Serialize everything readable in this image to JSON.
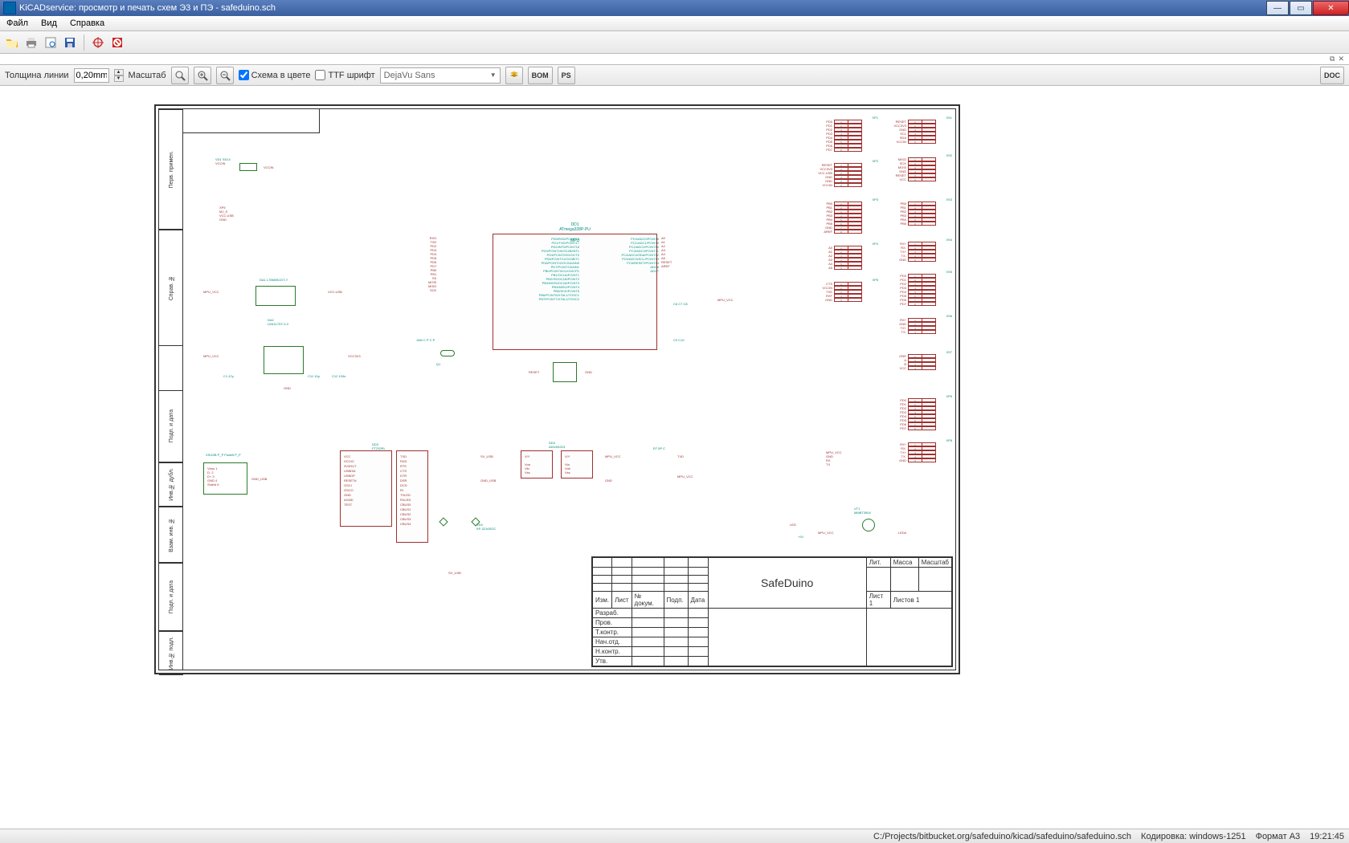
{
  "window": {
    "title": "KiCADservice: просмотр и печать схем Э3 и ПЭ - safeduino.sch"
  },
  "menu": {
    "file": "Файл",
    "view": "Вид",
    "help": "Справка"
  },
  "toolbar": {
    "open": "Открыть",
    "print": "Печать",
    "preview": "Предпросмотр",
    "save": "Сохранить",
    "target": "Цель",
    "stop": "Стоп"
  },
  "options": {
    "line_thickness_label": "Толщина линии",
    "line_thickness_value": "0,20mm",
    "scale_label": "Масштаб",
    "zoom_fit": "Вписать",
    "zoom_in": "+",
    "zoom_out": "−",
    "color_scheme_label": "Схема в цвете",
    "color_scheme_checked": true,
    "ttf_font_label": "TTF шрифт",
    "ttf_font_checked": false,
    "font_combo": "DejaVu Sans",
    "bom_btn": "BOM",
    "ps_btn": "PS",
    "doc_btn": "DOC",
    "tab_restore": "⧉",
    "tab_close": "✕"
  },
  "side_labels": {
    "perv_primen": "Перв. примен.",
    "sprav_no": "Справ. №",
    "podp_data1": "Подп. и дата",
    "inv_dubl": "Инв.№ дубл.",
    "vzam_inv": "Взам. инв. №",
    "podp_data2": "Подп. и дата",
    "inv_podl": "Инв.№ подл."
  },
  "titleblock": {
    "izm": "Изм.",
    "list": "Лист",
    "ndoc": "№ докум.",
    "podp": "Подп.",
    "data": "Дата",
    "razrab": "Разраб.",
    "prov": "Пров.",
    "tkontr": "Т.контр.",
    "nachotd": "Нач.отд.",
    "nkontr": "Н.контр.",
    "utv": "Утв.",
    "project": "SafeDuino",
    "lit": "Лит.",
    "massa": "Масса",
    "mashtab": "Масштаб",
    "list_no": "Лист 1",
    "listov": "Листов 1"
  },
  "schematic": {
    "main_chip_ref": "DD1",
    "main_chip_value": "ATmega328P-PU",
    "main_chip_label": "MPU",
    "usb_chip_ref": "DD3",
    "usb_chip_value": "FT232RL",
    "rs485_ref": "DD4",
    "rs485_value": "ADUM1201",
    "vreg_ref": "DA1  L78M05CDT-Y",
    "vreg2_ref": "DA2",
    "vreg2_value": "LM1117DT-3.3",
    "xtal": "Q1",
    "nets": {
      "vccin": "VCCIN",
      "vccusb": "VCC.USB",
      "vcc3v3": "VCC3V3",
      "mpu_vcc": "MPU_VCC",
      "gnd": "GND",
      "rxd": "RXD",
      "txd": "TXD",
      "reset": "RESET",
      "aref": "AREF",
      "sv_usb": "SV_USB",
      "miso": "MISO",
      "mosi": "MOSI",
      "sck": "SCK",
      "ss": "SS"
    },
    "pins_left": [
      "PD0/RXD/PCINT16",
      "PD1/TXD/PCINT17",
      "PD2/INT0/PCINT18",
      "PD3/PCINT19/OC2B/INT1",
      "PD4/PCINT20/XCK/T0",
      "PD5/PCINT21/OC0B/T1",
      "PD6/PCINT22/OC0A/AIN0",
      "PD7/PCINT23/AIN1",
      "PB0/PCINT0/CLKO/ICP1",
      "PB1/OC1A/PCINT1",
      "PB2/SS/OC1B/PCINT2",
      "PB3/MOSI/OC2A/PCINT3",
      "PB4/MISO/PCINT4",
      "PB5/SCK/PCINT5",
      "PB6/PCINT6/XTAL1/TOSC1",
      "PB7/PCINT7/XTAL2/TOSC2"
    ],
    "pins_right": [
      "PC0/ADC0/PCINT8",
      "PC1/ADC1/PCINT9",
      "PC2/ADC2/PCINT10",
      "PC3/ADC3/PCINT11",
      "PC4/ADC4/SDA/PCINT12",
      "PC5/ADC5/SCL/PCINT13",
      "PC6/RESET/PCINT14",
      "ADC6",
      "ADC7"
    ],
    "connectors": {
      "xp1": [
        "PD0",
        "PD1",
        "PD2",
        "PD3",
        "PD4",
        "PD5",
        "PD6",
        "PD7"
      ],
      "xp2": [
        "RESET",
        "VCC3V3",
        "VCC.USB",
        "GND",
        "GND",
        "VCCIN"
      ],
      "xp3": [
        "PB0",
        "PB1",
        "PB2",
        "PB3",
        "PB4",
        "PB5",
        "GND",
        "AREF"
      ],
      "xp4": [
        "A0",
        "A1",
        "A2",
        "A3",
        "A4",
        "A5"
      ],
      "xp5": [
        "CTS",
        "VCCIN",
        "TXE",
        "RXF",
        "GND"
      ],
      "xs1": [
        "RESET",
        "VCC3V3",
        "GND",
        "SCL",
        "SDA",
        "VCCIN"
      ],
      "xs2": [
        "MISO",
        "SCK",
        "MOSI",
        "GND",
        "RESET",
        "VCC"
      ],
      "xs3": [
        "PB0",
        "PB1",
        "PB2",
        "PB3",
        "PB4",
        "PB5"
      ],
      "xs4": [
        "RX+",
        "RX-",
        "TX+",
        "TX-",
        "GND"
      ],
      "xs5": [
        "PD0",
        "PD1",
        "PD2",
        "PD3",
        "PD4",
        "PD5",
        "PD6",
        "PD7"
      ],
      "xs6": [
        "RX+",
        "GND",
        "TX+",
        "TX-"
      ],
      "xs7": [
        "GND",
        "A",
        "B",
        "VCC"
      ]
    },
    "led_ref": "VD4",
    "led_value": "KP-3216SGC",
    "vt_ref": "VT1",
    "vt_value": "MMBT3904",
    "led_label": "LED"
  },
  "status": {
    "path": "C:/Projects/bitbucket.org/safeduino/kicad/safeduino/safeduino.sch",
    "encoding": "Кодировка: windows-1251",
    "format": "Формат A3",
    "time": "19:21:45"
  }
}
